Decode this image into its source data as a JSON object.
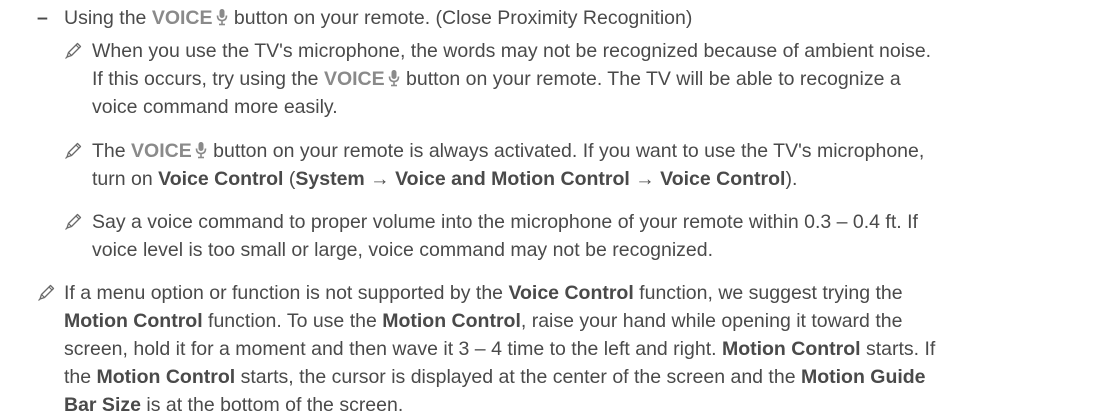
{
  "bullet": {
    "dash": "–",
    "part1": "Using the ",
    "voice_label": "VOICE",
    "part2": " button on your remote. (Close Proximity Recognition)"
  },
  "note1": {
    "l1": "When you use the TV's microphone, the words may not be recognized because of ambient noise.",
    "l2a": "If this occurs, try using the ",
    "voice_label": "VOICE",
    "l2b": " button on your remote. The TV will be able to recognize a",
    "l3": "voice command more easily."
  },
  "note2": {
    "l1a": "The ",
    "voice_label": "VOICE",
    "l1b": " button on your remote is always activated. If you want to use the TV's microphone,",
    "l2a": "turn on ",
    "voice_control": "Voice Control",
    "paren_open": " (",
    "system": "System",
    "arrow1": " → ",
    "vmc": "Voice and Motion Control",
    "arrow2": " → ",
    "voice_control2": "Voice Control",
    "paren_close": ")."
  },
  "note3": {
    "l1": "Say a voice command to proper volume into the microphone of your remote within 0.3 – 0.4 ft. If",
    "l2": "voice level is too small or large, voice command may not be recognized."
  },
  "note4": {
    "l1a": "If a menu option or function is not supported by the ",
    "voice_control": "Voice Control",
    "l1b": " function, we suggest trying the",
    "motion_control": "Motion Control",
    "l2a": " function. To use the ",
    "l2b": ", raise your hand while opening it toward the",
    "l3a": "screen, hold it for a moment and then wave it 3 – 4 time to the left and right. ",
    "l3b": " starts. If",
    "l4a": "the ",
    "l4b": " starts, the cursor is displayed at the center of the screen and the ",
    "motion_guide": "Motion Guide",
    "bar_size": "Bar Size",
    "l5b": " is at the bottom of the screen."
  }
}
